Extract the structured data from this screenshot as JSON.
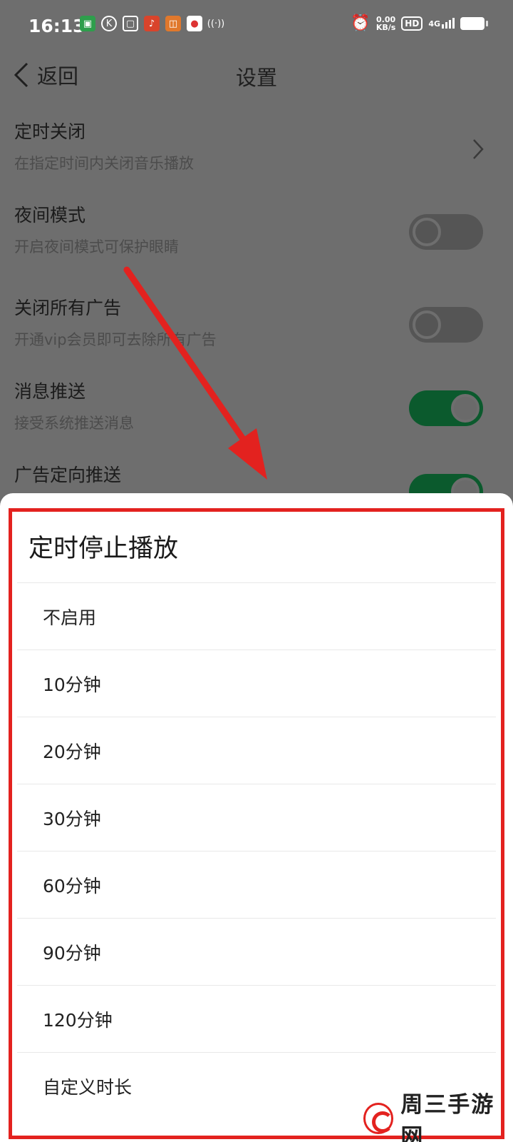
{
  "status_bar": {
    "time": "16:13",
    "net_speed_value": "0.00",
    "net_speed_unit": "KB/s",
    "hd": "HD",
    "signal": "4G"
  },
  "header": {
    "back_label": "返回",
    "title": "设置"
  },
  "settings": [
    {
      "title": "定时关闭",
      "subtitle": "在指定时间内关闭音乐播放",
      "control": "chevron"
    },
    {
      "title": "夜间模式",
      "subtitle": "开启夜间模式可保护眼睛",
      "control": "toggle",
      "on": false
    },
    {
      "title": "关闭所有广告",
      "subtitle": "开通vip会员即可去除所有广告",
      "control": "toggle",
      "on": false
    },
    {
      "title": "消息推送",
      "subtitle": "接受系统推送消息",
      "control": "toggle",
      "on": true
    },
    {
      "title": "广告定向推送",
      "subtitle": "",
      "control": "toggle",
      "on": true
    }
  ],
  "sheet": {
    "title": "定时停止播放",
    "options": [
      "不启用",
      "10分钟",
      "20分钟",
      "30分钟",
      "60分钟",
      "90分钟",
      "120分钟",
      "自定义时长"
    ]
  },
  "watermark": {
    "text": "周三手游网"
  },
  "colors": {
    "overlay_bg": "#6e6e6e",
    "toggle_on": "#0b5a2d",
    "highlight": "#e3221f"
  }
}
